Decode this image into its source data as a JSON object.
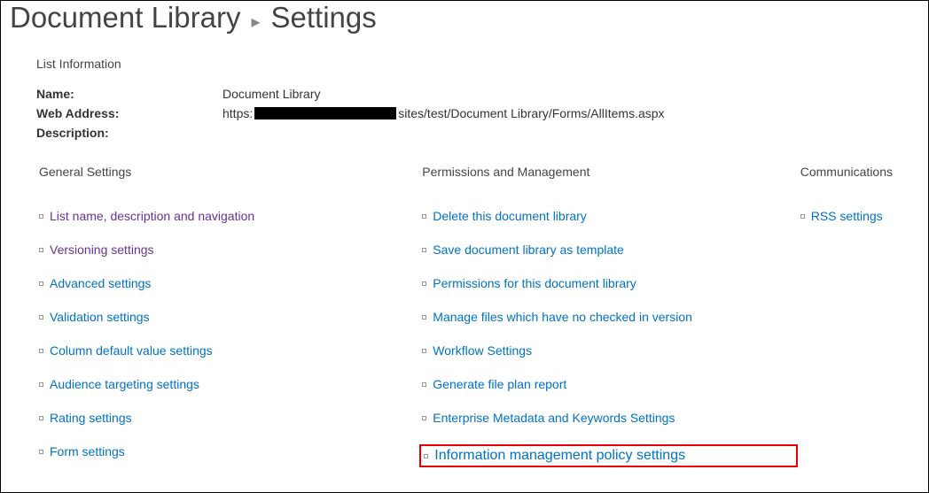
{
  "breadcrumb": {
    "parent": "Document Library",
    "current": "Settings"
  },
  "listInfo": {
    "sectionLabel": "List Information",
    "nameLabel": "Name:",
    "nameValue": "Document Library",
    "webAddressLabel": "Web Address:",
    "urlPrefix": "https:",
    "urlSuffix": "sites/test/Document Library/Forms/AllItems.aspx",
    "descriptionLabel": "Description:"
  },
  "columns": {
    "general": {
      "header": "General Settings",
      "links": [
        "List name, description and navigation",
        "Versioning settings",
        "Advanced settings",
        "Validation settings",
        "Column default value settings",
        "Audience targeting settings",
        "Rating settings",
        "Form settings"
      ]
    },
    "perms": {
      "header": "Permissions and Management",
      "links": [
        "Delete this document library",
        "Save document library as template",
        "Permissions for this document library",
        "Manage files which have no checked in version",
        "Workflow Settings",
        "Generate file plan report",
        "Enterprise Metadata and Keywords Settings",
        "Information management policy settings"
      ]
    },
    "comms": {
      "header": "Communications",
      "links": [
        "RSS settings"
      ]
    }
  }
}
